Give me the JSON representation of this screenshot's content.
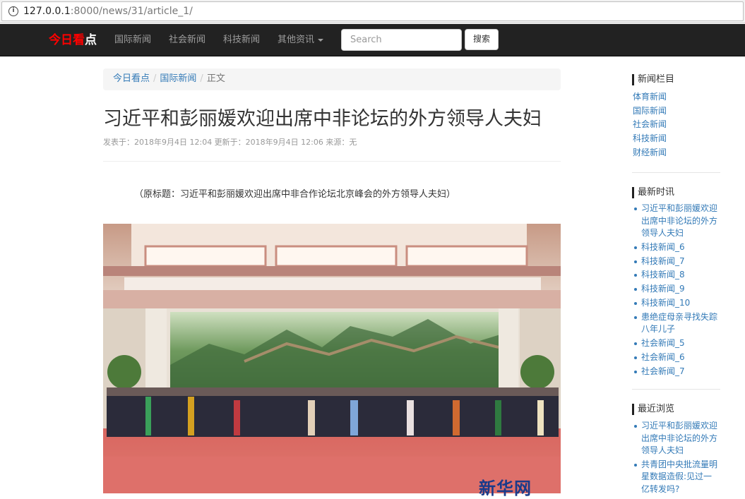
{
  "browser": {
    "url_host": "127.0.0.1",
    "url_path": ":8000/news/31/article_1/"
  },
  "navbar": {
    "brand_red": "今日看",
    "brand_white": "点",
    "links": [
      "国际新闻",
      "社会新闻",
      "科技新闻",
      "其他资讯"
    ],
    "search_placeholder": "Search",
    "search_button": "搜索"
  },
  "breadcrumb": {
    "home": "今日看点",
    "category": "国际新闻",
    "current": "正文"
  },
  "article": {
    "title": "习近平和彭丽媛欢迎出席中非论坛的外方领导人夫妇",
    "meta": "发表于：2018年9月4日 12:04 更新于：2018年9月4日 12:06 来源：无",
    "lead": "（原标题：习近平和彭丽媛欢迎出席中非合作论坛北京峰会的外方领导人夫妇）",
    "photo_watermark": "新华网"
  },
  "sidebar": {
    "columns_title": "新闻栏目",
    "columns": [
      "体育新闻",
      "国际新闻",
      "社会新闻",
      "科技新闻",
      "财经新闻"
    ],
    "latest_title": "最新时讯",
    "latest": [
      "习近平和彭丽媛欢迎出席中非论坛的外方领导人夫妇",
      "科技新闻_6",
      "科技新闻_7",
      "科技新闻_8",
      "科技新闻_9",
      "科技新闻_10",
      "患绝症母亲寻找失踪八年儿子",
      "社会新闻_5",
      "社会新闻_6",
      "社会新闻_7"
    ],
    "recent_title": "最近浏览",
    "recent": [
      "习近平和彭丽媛欢迎出席中非论坛的外方领导人夫妇",
      "共青团中央批流量明星数据造假:见过一亿转发吗?"
    ]
  }
}
